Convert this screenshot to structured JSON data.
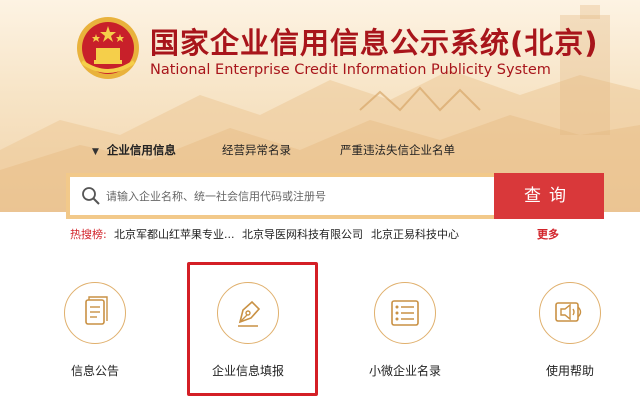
{
  "header": {
    "title_cn": "国家企业信用信息公示系统(北京)",
    "title_en": "National Enterprise Credit Information Publicity System"
  },
  "tabs": [
    {
      "label": "企业信用信息",
      "active": true
    },
    {
      "label": "经营异常名录",
      "active": false
    },
    {
      "label": "严重违法失信企业名单",
      "active": false
    }
  ],
  "search": {
    "placeholder": "请输入企业名称、统一社会信用代码或注册号",
    "value": "",
    "button_label": "查询"
  },
  "hot": {
    "label": "热搜榜:",
    "items": [
      "北京军都山红苹果专业...",
      "北京导医网科技有限公司",
      "北京正易科技中心"
    ],
    "more_label": "更多"
  },
  "services": [
    {
      "label": "信息公告",
      "icon": "document-icon"
    },
    {
      "label": "企业信息填报",
      "icon": "pen-nib-icon",
      "highlighted": true
    },
    {
      "label": "小微企业名录",
      "icon": "list-icon"
    },
    {
      "label": "使用帮助",
      "icon": "speaker-icon"
    }
  ],
  "colors": {
    "brand_red": "#a8151b",
    "button_red": "#d9383a",
    "gold": "#e0b06d",
    "highlight_border": "#d41f26"
  }
}
